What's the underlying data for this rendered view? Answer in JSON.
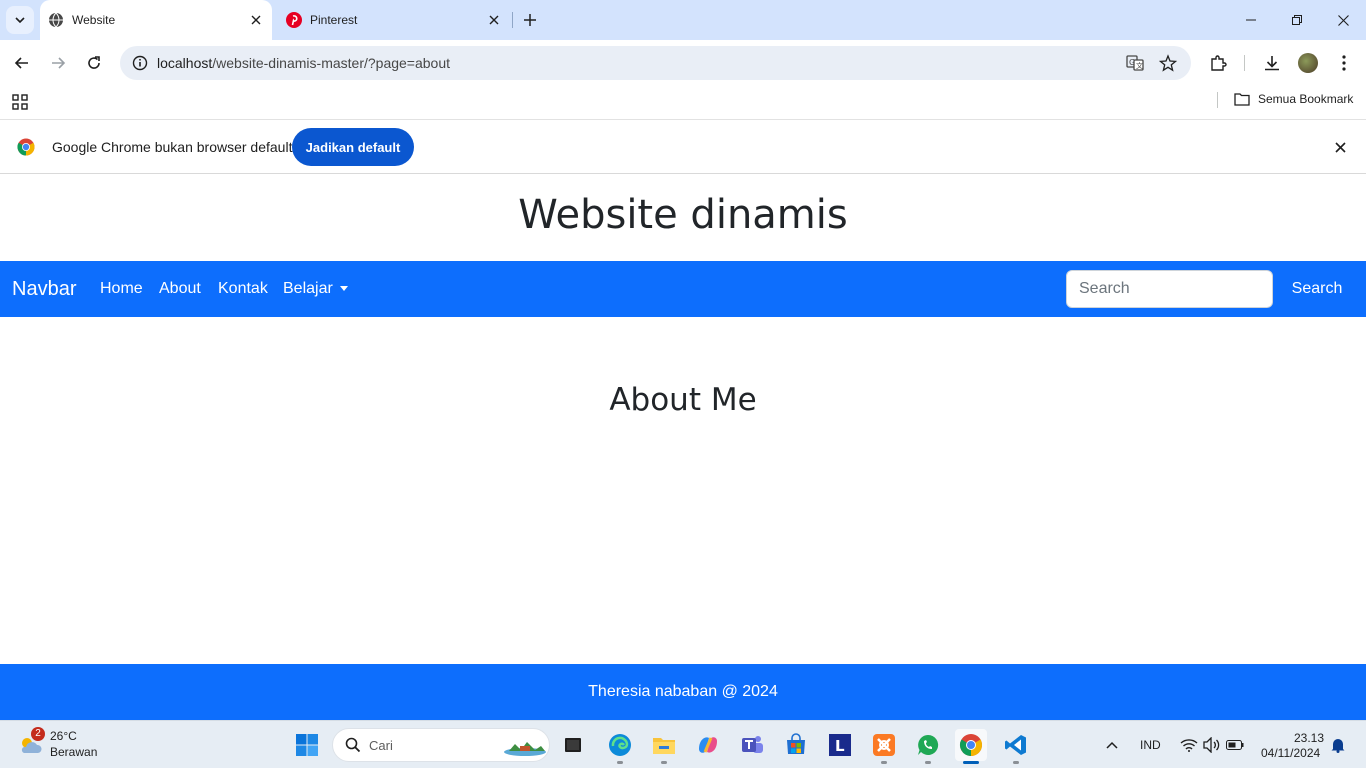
{
  "browser": {
    "tabs": [
      {
        "title": "Website",
        "active": true,
        "icon": "globe-icon"
      },
      {
        "title": "Pinterest",
        "active": false,
        "icon": "pinterest-icon"
      }
    ],
    "url": {
      "host": "localhost",
      "path": "/website-dinamis-master/?page=about"
    },
    "bookmarks_all_label": "Semua Bookmark",
    "infobar": {
      "message": "Google Chrome bukan browser default",
      "button_label": "Jadikan default"
    },
    "colors": {
      "tabstrip": "#d3e3fd",
      "infobar_button": "#0b57d0"
    }
  },
  "page": {
    "site_title": "Website dinamis",
    "navbar": {
      "brand": "Navbar",
      "links": [
        "Home",
        "About",
        "Kontak",
        "Belajar"
      ],
      "search_placeholder": "Search",
      "search_button": "Search"
    },
    "heading": "About Me",
    "footer": "Theresia nababan @ 2024",
    "colors": {
      "primary": "#0d6efd",
      "text": "#212529"
    }
  },
  "taskbar": {
    "weather": {
      "badge": "2",
      "temp": "26°C",
      "condition": "Berawan"
    },
    "search_placeholder": "Cari",
    "apps": [
      "windows-start-icon",
      "file-manager-icon",
      "edge-icon",
      "folder-icon",
      "copilot-icon",
      "teams-icon",
      "store-icon",
      "l-app-icon",
      "xampp-icon",
      "whatsapp-icon",
      "chrome-icon",
      "vscode-icon"
    ],
    "language": "IND",
    "time": "23.13",
    "date": "04/11/2024"
  }
}
